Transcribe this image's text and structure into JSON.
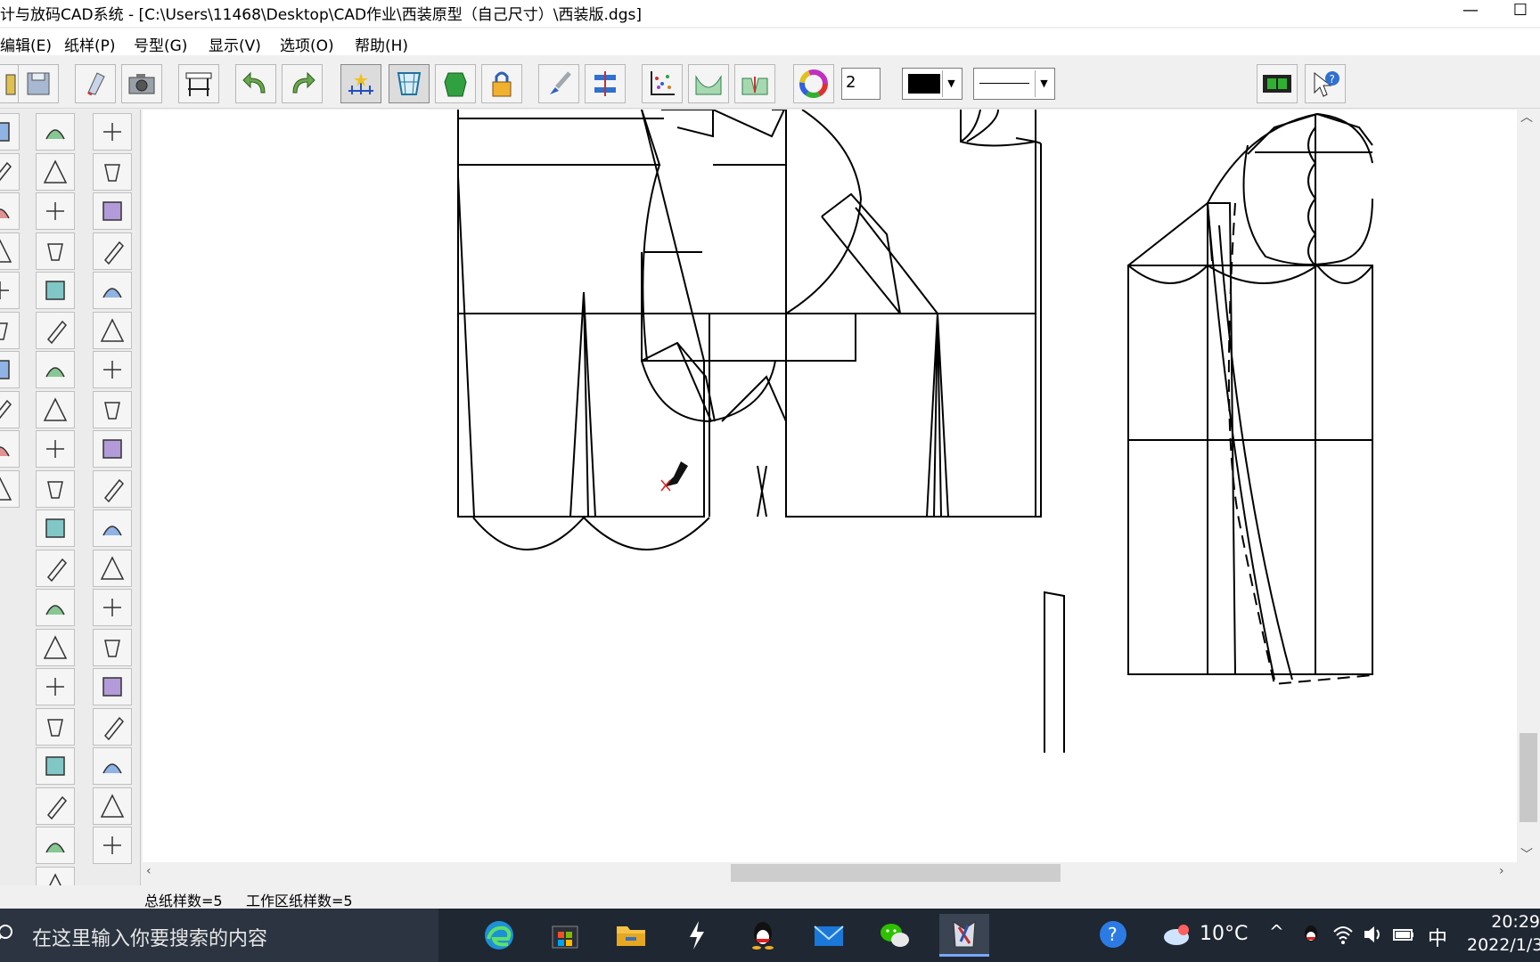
{
  "window": {
    "title": "计与放码CAD系统 - [C:\\Users\\11468\\Desktop\\CAD作业\\西装原型（自己尺寸）\\西装版.dgs]",
    "minimize_glyph": "—",
    "maximize_glyph": "☐"
  },
  "menu": {
    "items": [
      {
        "label": "编辑(E)"
      },
      {
        "label": "纸样(P)"
      },
      {
        "label": "号型(G)"
      },
      {
        "label": "显示(V)"
      },
      {
        "label": "选项(O)"
      },
      {
        "label": "帮助(H)"
      }
    ]
  },
  "toolbar": {
    "line_width_value": "2",
    "color_value": "#000000",
    "icons": [
      "open-icon",
      "save-icon",
      "print-icon",
      "camera-icon",
      "plotter-icon",
      "undo-icon",
      "redo-icon",
      "point-marker-icon",
      "grid-icon",
      "piece-icon",
      "lock-icon",
      "brush-icon",
      "align-icon",
      "scatter-icon",
      "curve-icon",
      "dart-icon",
      "color-wheel-icon",
      "film-icon",
      "help-arrow-icon"
    ]
  },
  "status": {
    "total_patterns": "总纸样数=5",
    "workspace_patterns": "工作区纸样数=5"
  },
  "taskbar": {
    "search_placeholder": "在这里输入你要搜索的内容",
    "temperature": "10°C",
    "ime_label": "中",
    "time": "20:29",
    "date": "2022/1/3",
    "apps": [
      "edge-icon",
      "store-icon",
      "folder-icon",
      "pen-app-icon",
      "qq-icon",
      "mail-icon",
      "wechat-icon",
      "cad-app-icon"
    ]
  },
  "colors": {
    "taskbar_bg": "#1f2732",
    "canvas_bg": "#ffffff",
    "pattern_line": "#000000",
    "cursor_mark": "#e02020"
  }
}
